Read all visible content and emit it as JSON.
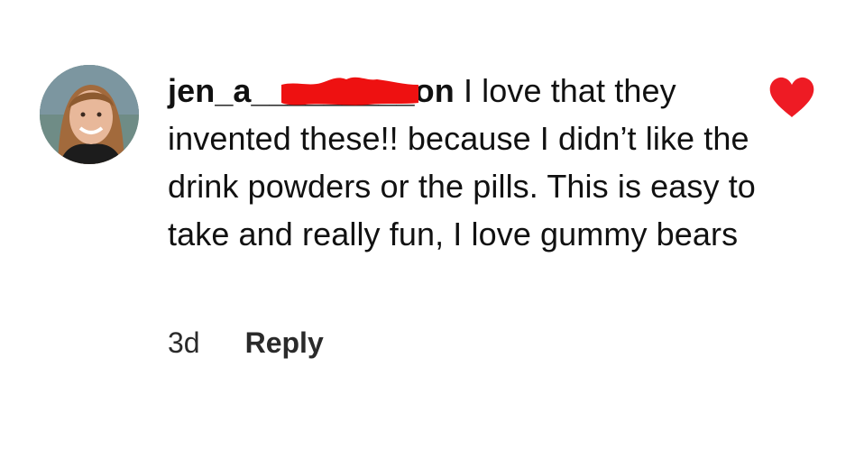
{
  "comment": {
    "username": "jen_a_________on",
    "text": "I love that they invented these!! because I didn’t like the drink powders or the pills. This is easy to take and really fun, I love gummy bears",
    "age": "3d",
    "reply_label": "Reply",
    "liked": true,
    "avatar_icon": "profile-photo",
    "like_icon": "heart-icon",
    "redaction_color": "#ee1111",
    "heart_color": "#ee1b24"
  }
}
